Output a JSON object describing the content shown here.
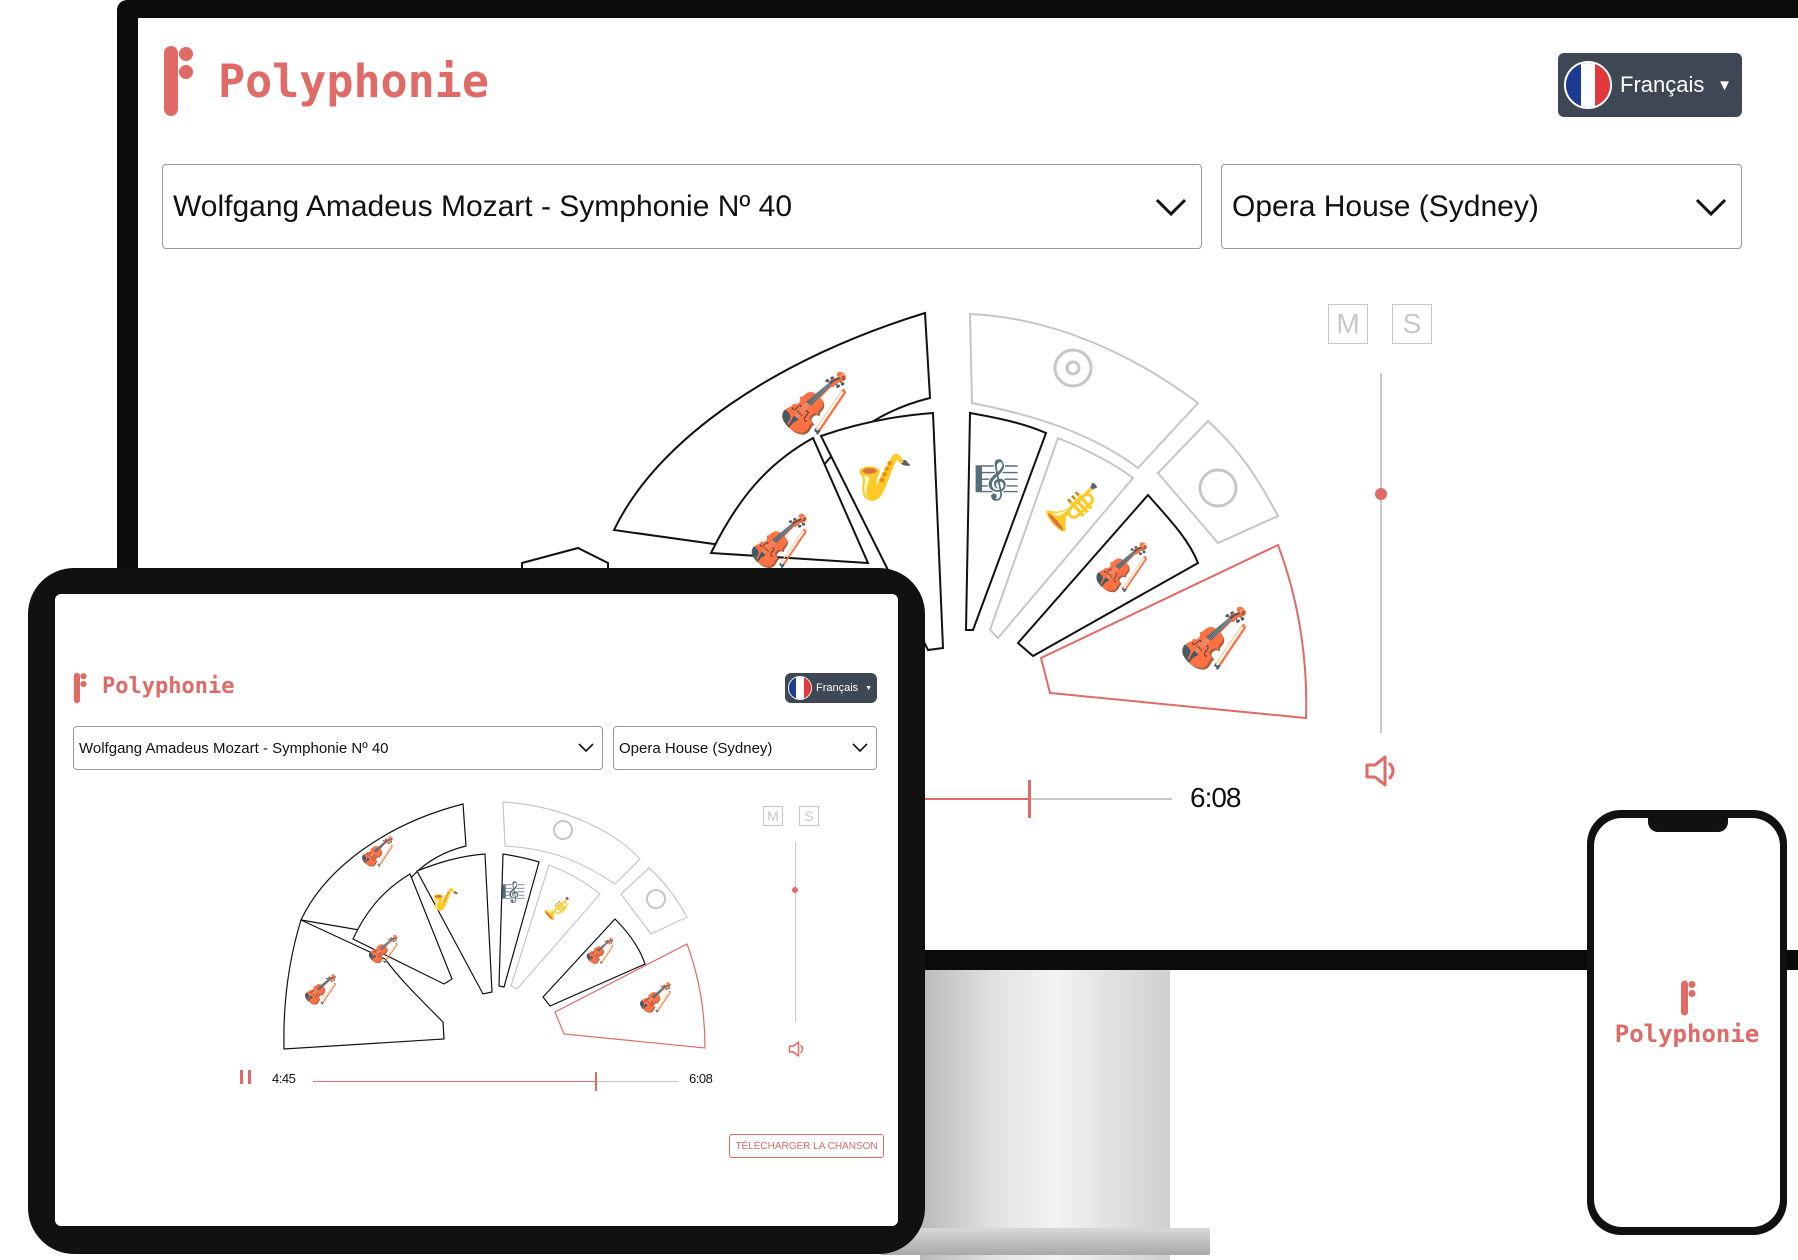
{
  "brand": {
    "name": "Polyphonie",
    "color": "#e06a66"
  },
  "language": {
    "label": "Français",
    "flag": "french-flag",
    "colors": [
      "#1d3a95",
      "#ffffff",
      "#e2383c"
    ]
  },
  "piece_select": {
    "value": "Wolfgang Amadeus Mozart - Symphonie Nº 40"
  },
  "venue_select": {
    "value": "Opera House (Sydney)"
  },
  "mixer": {
    "mute_label": "M",
    "solo_label": "S",
    "volume": 0.74,
    "volume_icon": "speaker-icon"
  },
  "player": {
    "current_time": "4:45",
    "total_time": "6:08",
    "progress": 0.78,
    "pause_icon": "pause-icon"
  },
  "download": {
    "label": "TÉLÉCHARGER LA CHANSON"
  },
  "orchestra": {
    "sections": [
      {
        "id": "cello",
        "icon": "cello-icon",
        "state": "active"
      },
      {
        "id": "violin-2",
        "icon": "violin-icon",
        "state": "active"
      },
      {
        "id": "bassoon",
        "icon": "bassoon-icon",
        "state": "muted"
      },
      {
        "id": "flute",
        "icon": "flute-icon",
        "state": "active"
      },
      {
        "id": "percussion",
        "icon": "drum-icon",
        "state": "muted"
      },
      {
        "id": "trumpet",
        "icon": "trumpet-icon",
        "state": "muted"
      },
      {
        "id": "horn",
        "icon": "horn-icon",
        "state": "muted"
      },
      {
        "id": "viola",
        "icon": "viola-icon",
        "state": "active"
      },
      {
        "id": "violin-1",
        "icon": "violin-icon",
        "state": "selected"
      },
      {
        "id": "contrabass",
        "icon": "contrabass-icon",
        "state": "active"
      }
    ],
    "colors": {
      "active": "#111111",
      "muted": "#c6c6c6",
      "selected": "#e06a66"
    }
  }
}
